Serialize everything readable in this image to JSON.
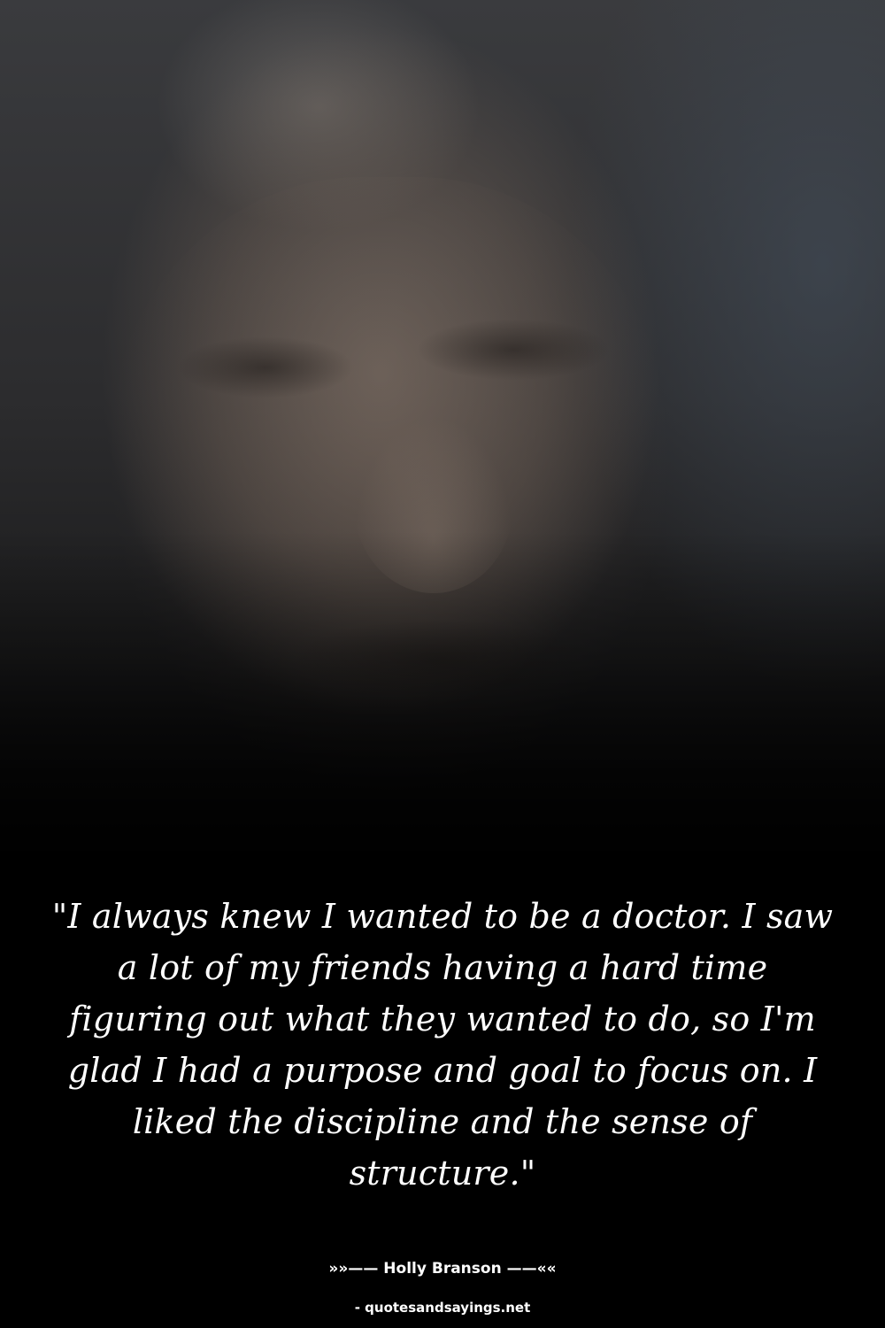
{
  "background": {
    "image": "dark-portrait-photo",
    "accent": "#000000"
  },
  "quote": {
    "text": "\"I always knew I wanted to be a doctor. I saw a lot of my friends having a hard time figuring out what they wanted to do, so I'm glad I had a purpose and goal to focus on. I liked the discipline and the sense of structure.\""
  },
  "author": {
    "text": "»»—— Holly Branson ——««"
  },
  "source": {
    "text": "- quotesandsayings.net"
  }
}
